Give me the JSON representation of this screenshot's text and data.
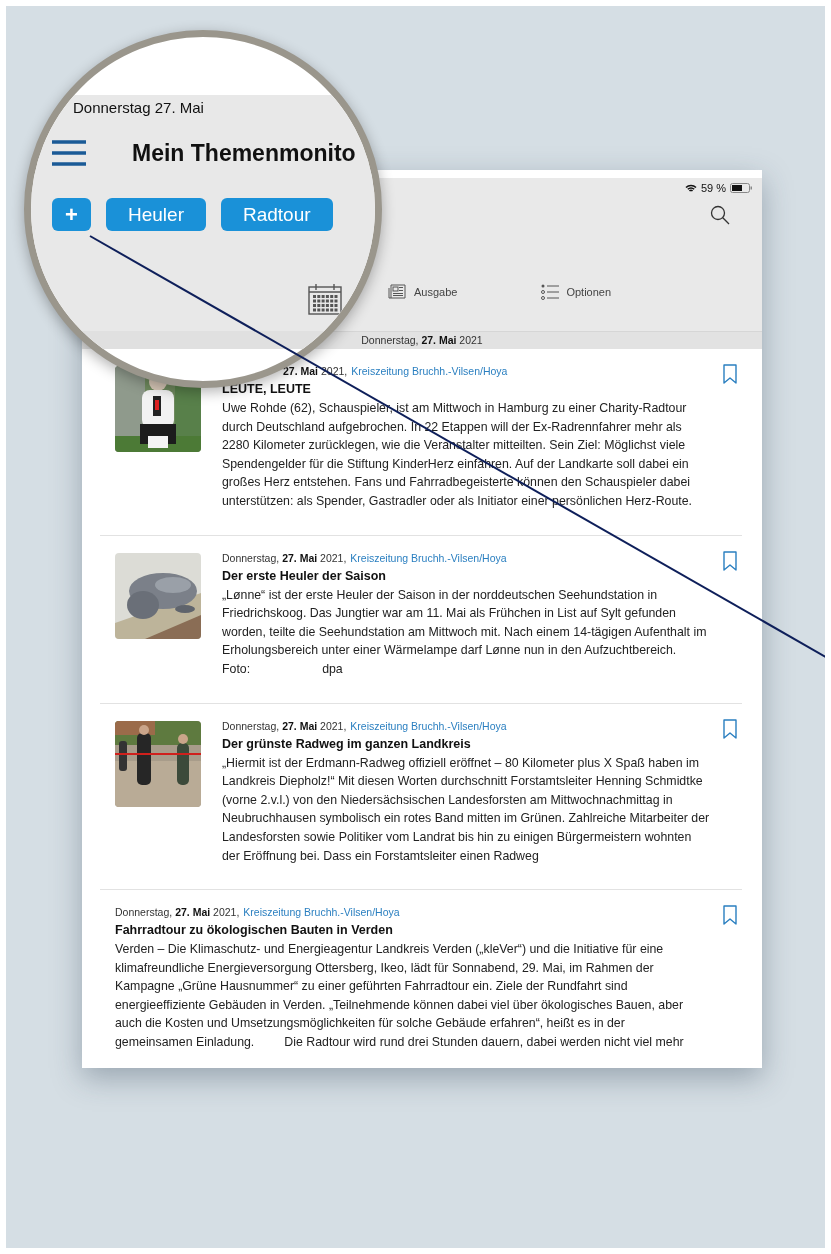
{
  "magnifier": {
    "status_date": "Donnerstag 27. Mai",
    "title": "Mein Themenmonito",
    "add_button": "+",
    "topics": [
      {
        "label": "Heuler"
      },
      {
        "label": "Radtour"
      }
    ]
  },
  "status_bar": {
    "battery": "59 %"
  },
  "toolbar": [
    {
      "kind": "edition",
      "label": "Ausgabe"
    },
    {
      "kind": "options",
      "label": "Optionen"
    }
  ],
  "date_bar": "Donnerstag, **27. Mai** 2021",
  "articles": [
    {
      "date": "**27. Mai** 2021,",
      "source": "Kreiszeitung Bruchh.-Vilsen/Hoya",
      "title": "LEUTE, LEUTE",
      "image": {
        "kind": "picture"
      },
      "body": [
        "Uwe Rohde (62), Schauspieler, ist am Mittwoch in Hamburg zu einer Charity-Radtour durch Deutschland aufgebrochen. In 22 Etappen will der Ex-Radrennfahrer mehr als 2280 Kilometer zurücklegen, wie die Veranstalter mitteilten. Sein Ziel: Möglichst viele Spendengelder für die Stiftung KinderHerz einfahren. Auf der Landkarte soll dabei ein großes Herz entstehen. Fans und Fahrradbegeisterte können den Schauspieler dabei unterstützen: als Spender, Gastradler oder als Initiator einer persönlichen Herz-Route."
      ]
    },
    {
      "date": "Donnerstag, **27. Mai** 2021,",
      "source": "Kreiszeitung Bruchh.-Vilsen/Hoya",
      "title": "Der erste Heuler der Saison",
      "image": {
        "kind": "picture"
      },
      "body": [
        "„Lønne“ ist der erste Heuler der Saison in der norddeutschen Seehundstation in Friedrichskoog. Das Jungtier war am 11. Mai als Frühchen in List auf Sylt gefunden worden, teilte die Seehundstation am Mittwoch mit. Nach einem 14-tägigen Aufenthalt im Erholungsbereich unter einer Wärmelampe darf Lønne nun in den Aufzuchtbereich."
      ],
      "credit": [
        "Foto:",
        "dpa"
      ]
    },
    {
      "date": "Donnerstag, **27. Mai** 2021,",
      "source": "Kreiszeitung Bruchh.-Vilsen/Hoya",
      "title": "Der grünste Radweg im ganzen Landkreis",
      "image": {
        "kind": "picture"
      },
      "body": [
        "„Hiermit ist der Erdmann-Radweg offiziell eröffnet – 80 Kilometer plus X Spaß haben im Landkreis Diepholz!“ Mit diesen Worten durchschnitt Forstamtsleiter Henning Schmidtke (vorne 2.v.l.) von den Niedersächsischen Landesforsten am Mittwochnachmittag in Neubruchhausen symbolisch ein rotes Band mitten im Grünen. Zahlreiche Mitarbeiter der Landesforsten sowie Politiker vom Landrat bis hin zu einigen Bürgermeistern wohnten der Eröffnung bei. Dass ein Forstamtsleiter einen Radweg"
      ]
    },
    {
      "date": "Donnerstag, **27. Mai** 2021,",
      "source": "Kreiszeitung Bruchh.-Vilsen/Hoya",
      "title": "Fahrradtour zu ökologischen Bauten in Verden",
      "body": [
        "Verden – Die Klimaschutz- und Energieagentur Landkreis Verden („kleVer“) und die Initiative für eine klimafreundliche Energieversorgung Ottersberg, Ikeo, lädt für Sonnabend, 29. Mai, im Rahmen der Kampagne „Grüne Hausnummer“ zu einer geführten Fahrradtour ein. Ziele der Rundfahrt sind energieeffiziente Gebäuden in Verden. „Teilnehmende können dabei viel über ökologisches Bauen, aber auch die Kosten und Umsetzungsmöglichkeiten für solche Gebäude erfahren“, heißt es in der"
      ],
      "last_line": [
        "gemeinsamen Einladung.",
        "Die Radtour wird rund drei Stunden dauern, dabei werden nicht viel mehr"
      ]
    }
  ]
}
